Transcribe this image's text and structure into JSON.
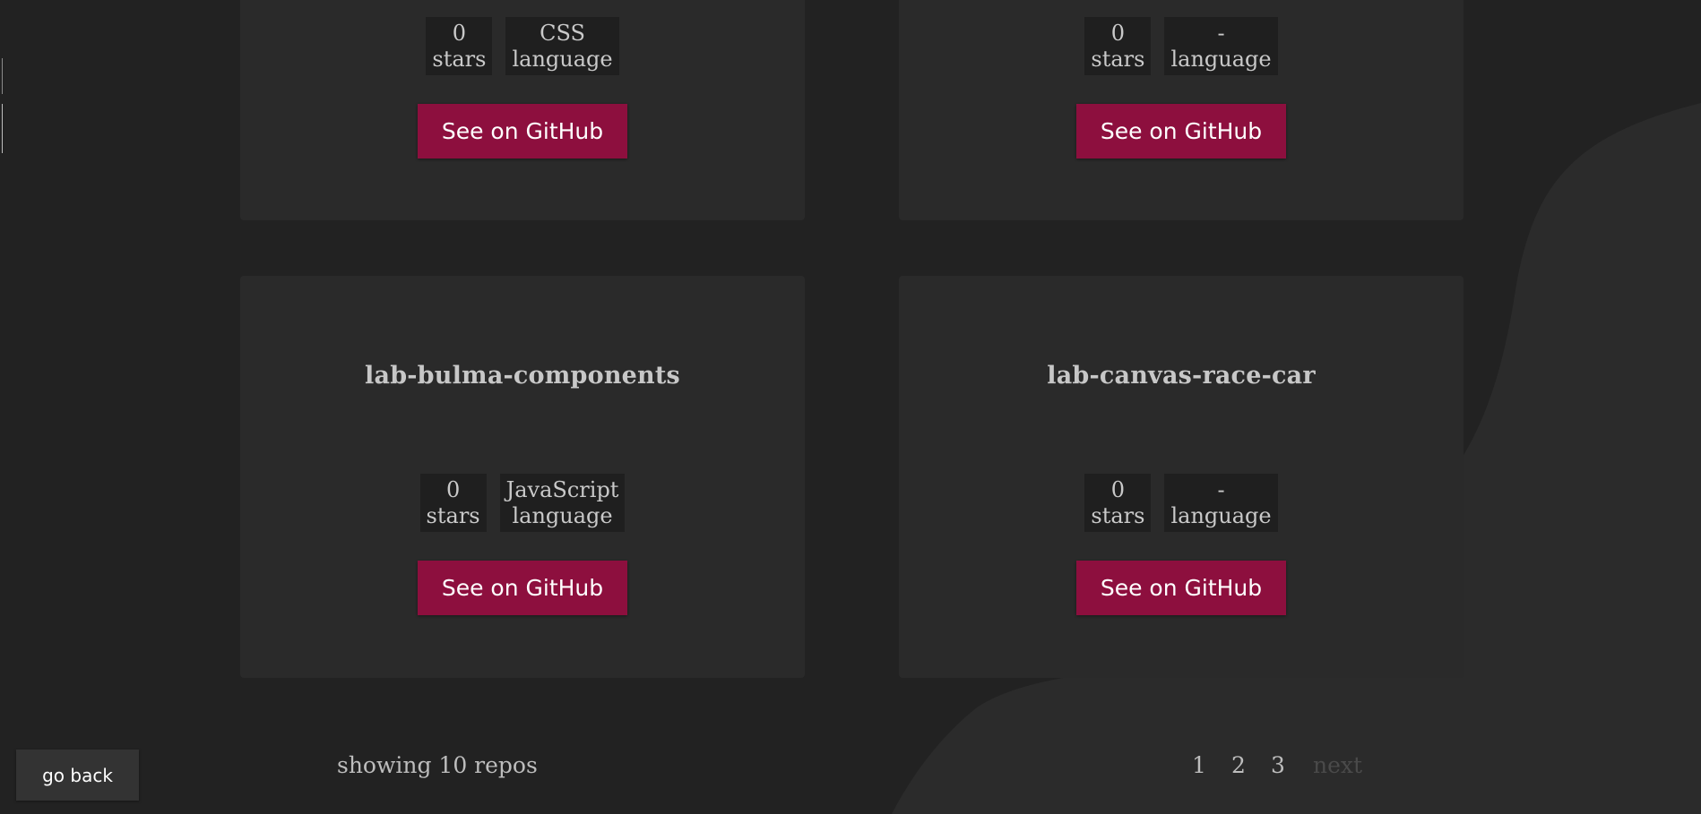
{
  "repos": [
    {
      "name": "",
      "stars_value": "0",
      "stars_label": "stars",
      "language_value": "CSS",
      "language_label": "language",
      "button_label": "See on GitHub"
    },
    {
      "name": "",
      "stars_value": "0",
      "stars_label": "stars",
      "language_value": "-",
      "language_label": "language",
      "button_label": "See on GitHub"
    },
    {
      "name": "lab-bulma-components",
      "stars_value": "0",
      "stars_label": "stars",
      "language_value": "JavaScript",
      "language_label": "language",
      "button_label": "See on GitHub"
    },
    {
      "name": "lab-canvas-race-car",
      "stars_value": "0",
      "stars_label": "stars",
      "language_value": "-",
      "language_label": "language",
      "button_label": "See on GitHub"
    }
  ],
  "footer": {
    "showing_text": "showing 10 repos",
    "pages": [
      "1",
      "2",
      "3"
    ],
    "next_label": "next"
  },
  "go_back_label": "go back",
  "colors": {
    "background": "#222222",
    "card": "#2a2a2a",
    "accent": "#8d0f3e",
    "stat_bg": "#1f1f1f"
  }
}
